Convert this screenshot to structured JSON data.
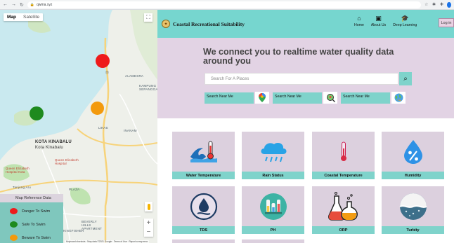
{
  "browser": {
    "url": "qwma.xyz"
  },
  "map": {
    "tabs": [
      {
        "label": "Map",
        "active": true
      },
      {
        "label": "Satellite",
        "active": false
      }
    ],
    "labels": {
      "city": "KOTA KINABALU",
      "city_local": "Kota Kinabalu",
      "alamesra": "ALAMESRA",
      "kampung": "KAMPUNG SEPANGGAR",
      "likas": "LIKAS",
      "inanam": "INANAM",
      "hospital": "Queen Elizabeth Hospital",
      "hospital2": "Queen Elizabeth Hospital Kota",
      "tanjung": "Tanjung Aru",
      "plaza": "PLAZA",
      "beverly": "BEVERLY HILLS APARTMENT",
      "kingfisher": "KINGFISHER"
    },
    "footer": "Keyboard shortcuts · Map data ©2021 Google · Terms of Use · Report a map error",
    "marker_colors": {
      "danger": "#ee1b1b",
      "safe": "#1e8a1e",
      "beware": "#f39a0d"
    }
  },
  "legend": {
    "title": "Map Reference Data",
    "items": [
      {
        "label": "Danger To Swim",
        "color": "#ee1b1b"
      },
      {
        "label": "Safe To Swim",
        "color": "#1e8a1e"
      },
      {
        "label": "Beware To Swim",
        "color": "#f39a0d"
      }
    ]
  },
  "navbar": {
    "brand": "Coastal Recreational Suitability",
    "items": [
      {
        "label": "Home",
        "icon": "home-icon"
      },
      {
        "label": "About Us",
        "icon": "document-icon"
      },
      {
        "label": "Deep Learning",
        "icon": "graduation-cap-icon"
      }
    ],
    "login": "Log in"
  },
  "hero": {
    "title": "We connect you to realtime water quality data around you",
    "search_placeholder": "Search For A Places",
    "near": [
      {
        "label": "Search Near Me",
        "icon": "google-maps-icon"
      },
      {
        "label": "Search Near Me",
        "icon": "location-search-icon"
      },
      {
        "label": "Search Near Me",
        "icon": "globe-icon"
      }
    ]
  },
  "cards": [
    {
      "label": "Water Temperature",
      "icon": "water-temperature-icon"
    },
    {
      "label": "Rain Status",
      "icon": "rain-cloud-icon"
    },
    {
      "label": "Coastal Temperature",
      "icon": "thermometer-icon"
    },
    {
      "label": "Humidity",
      "icon": "humidity-icon"
    },
    {
      "label": "TDS",
      "icon": "water-drop-icon"
    },
    {
      "label": "PH",
      "icon": "test-tube-icon"
    },
    {
      "label": "ORP",
      "icon": "flask-icon"
    },
    {
      "label": "Turbity",
      "icon": "turbidity-icon"
    }
  ]
}
